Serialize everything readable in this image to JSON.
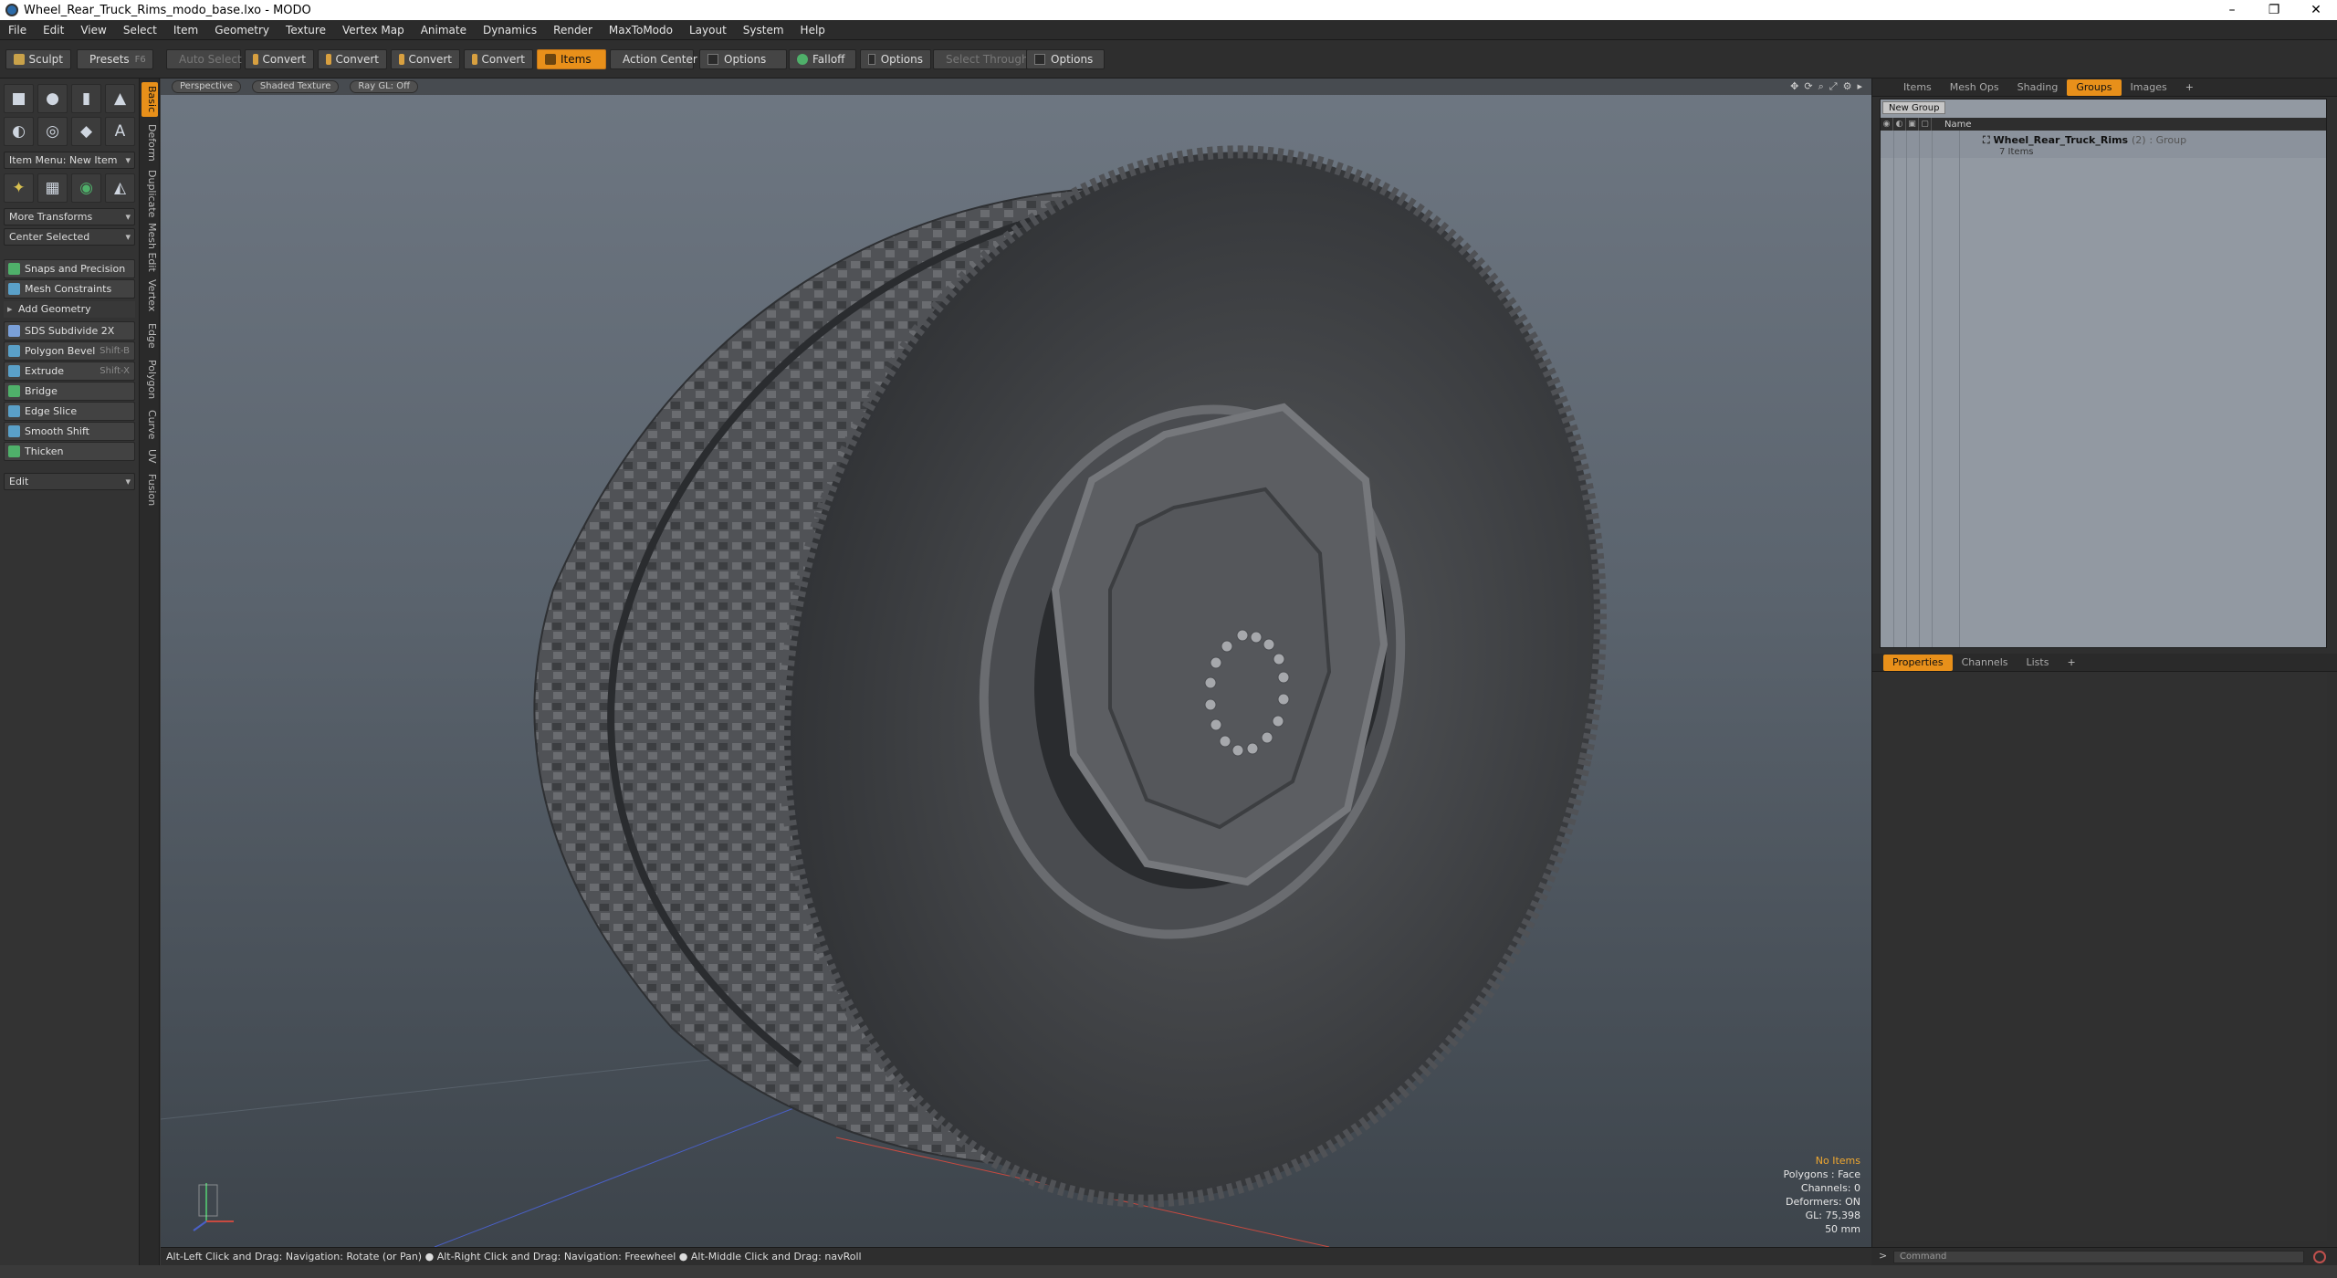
{
  "window": {
    "title": "Wheel_Rear_Truck_Rims_modo_base.lxo - MODO",
    "controls": [
      "–",
      "❐",
      "✕"
    ]
  },
  "menu": [
    "File",
    "Edit",
    "View",
    "Select",
    "Item",
    "Geometry",
    "Texture",
    "Vertex Map",
    "Animate",
    "Dynamics",
    "Render",
    "MaxToModo",
    "Layout",
    "System",
    "Help"
  ],
  "toolbar": {
    "sculpt": "Sculpt",
    "presets": "Presets",
    "presets_key": "F6",
    "auto_select": "Auto Select",
    "convert1": "Convert",
    "convert2": "Convert",
    "convert3": "Convert",
    "convert4": "Convert",
    "items": "Items",
    "action_center": "Action Center",
    "options1": "Options",
    "falloff": "Falloff",
    "options2": "Options",
    "select_through": "Select Through",
    "options3": "Options"
  },
  "left_tabs": [
    "Basic",
    "Deform",
    "Duplicate",
    "Mesh Edit",
    "Vertex",
    "Edge",
    "Polygon",
    "Curve",
    "UV",
    "Fusion"
  ],
  "left_panel": {
    "item_menu": "Item Menu: New Item",
    "more_transforms": "More Transforms",
    "center_selected": "Center Selected",
    "snaps": "Snaps and Precision",
    "mesh_constraints": "Mesh Constraints",
    "add_geometry": "Add Geometry",
    "tools": [
      {
        "label": "SDS Subdivide 2X",
        "shortcut": "",
        "color": "#7aa0d8"
      },
      {
        "label": "Polygon Bevel",
        "shortcut": "Shift-B",
        "color": "#5aa0c8"
      },
      {
        "label": "Extrude",
        "shortcut": "Shift-X",
        "color": "#5aa0c8"
      },
      {
        "label": "Bridge",
        "shortcut": "",
        "color": "#4fb06a"
      },
      {
        "label": "Edge Slice",
        "shortcut": "",
        "color": "#5aa0c8"
      },
      {
        "label": "Smooth Shift",
        "shortcut": "",
        "color": "#5aa0c8"
      },
      {
        "label": "Thicken",
        "shortcut": "",
        "color": "#4fb06a"
      }
    ],
    "edit": "Edit"
  },
  "viewport": {
    "view": "Perspective",
    "shading": "Shaded Texture",
    "raygl": "Ray GL: Off",
    "hud": {
      "selection": "No Items",
      "polygons": "Polygons : Face",
      "channels": "Channels: 0",
      "deformers": "Deformers: ON",
      "gl": "GL: 75,398",
      "lens": "50 mm"
    }
  },
  "status": "Alt-Left Click and Drag: Navigation: Rotate (or Pan) ● Alt-Right Click and Drag: Navigation: Freewheel ● Alt-Middle Click and Drag: navRoll",
  "right_panel": {
    "tabs_top": [
      "Items",
      "Mesh Ops",
      "Shading",
      "Groups",
      "Images",
      "+"
    ],
    "active_top": "Groups",
    "new_group": "New Group",
    "name_col": "Name",
    "group": {
      "name": "Wheel_Rear_Truck_Rims",
      "count": "(2)",
      "type": ": Group",
      "sub": "7 Items"
    },
    "tabs_bottom": [
      "Properties",
      "Channels",
      "Lists",
      "+"
    ],
    "active_bottom": "Properties",
    "command_placeholder": "Command"
  },
  "colors": {
    "accent": "#e8901a",
    "viewport_top": "#6e7782",
    "viewport_bottom": "#3d444b"
  }
}
